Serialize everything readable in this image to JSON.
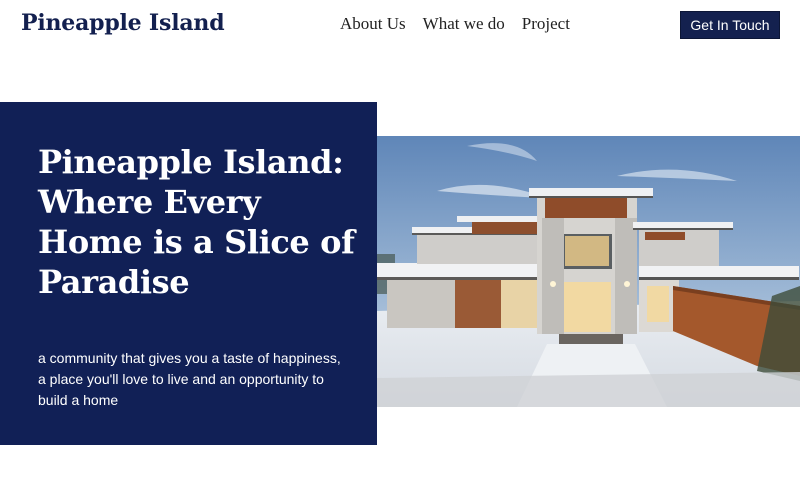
{
  "header": {
    "logo": "Pineapple Island",
    "nav": [
      {
        "label": "About Us"
      },
      {
        "label": "What we do"
      },
      {
        "label": "Project"
      }
    ],
    "cta_label": "Get In Touch"
  },
  "hero": {
    "title": "Pineapple Island: Where Every Home is a Slice of Paradise",
    "description": "a community that gives you a taste of happiness, a place you'll love to live and an opportunity to build a home",
    "image": "modern-house-in-snow-photo"
  },
  "colors": {
    "brand_navy": "#112056",
    "button_navy": "#14214f",
    "background": "#ffffff",
    "text_light": "#ffffff"
  }
}
